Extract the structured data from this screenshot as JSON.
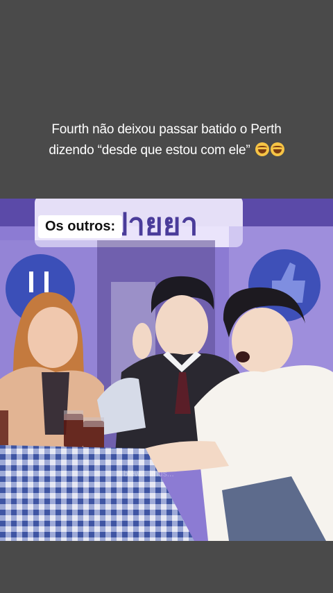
{
  "caption": {
    "line1": "Fourth não deixou passar batido o Perth",
    "line2": "dizendo  “desde que estou com ele”"
  },
  "emojis": [
    "rofl-emoji",
    "rofl-emoji"
  ],
  "overlay": {
    "label": "Os outros:"
  },
  "video": {
    "sign_text": "ชอนปายยา",
    "watermark": "blew... imus...",
    "colors": {
      "background": "#4a4a4a",
      "wall": "#8f7fd6",
      "tablecloth_blue": "#4a5fa8"
    }
  }
}
